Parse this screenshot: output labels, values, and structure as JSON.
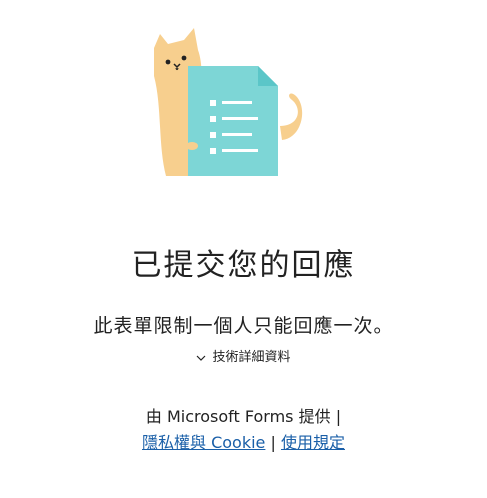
{
  "illustration": {
    "icon": "cat-with-document-icon",
    "colors": {
      "cat": "#f7cf8e",
      "document": "#7dd6d6",
      "document_fold": "#5bc6c8"
    }
  },
  "confirmation": {
    "title": "已提交您的回應",
    "message": "此表單限制一個人只能回應一次。",
    "details_label": "技術詳細資料"
  },
  "footer": {
    "powered_by": "由 Microsoft Forms 提供 |",
    "privacy_link": "隱私權與 Cookie",
    "separator": "|",
    "terms_link": "使用規定"
  },
  "colors": {
    "link": "#1a5fa8",
    "text": "#222222"
  }
}
